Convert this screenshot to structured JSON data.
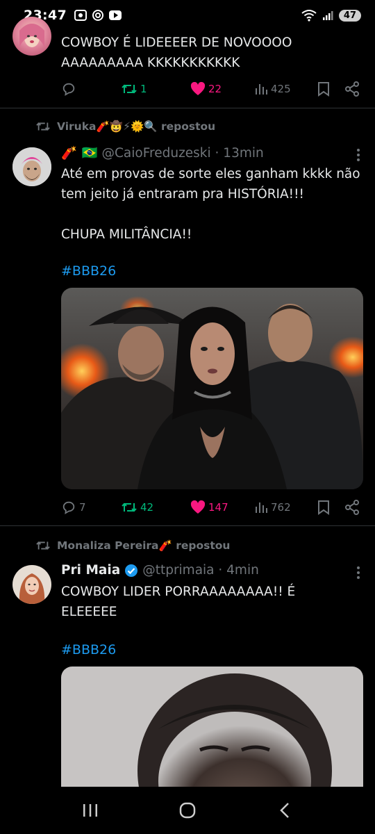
{
  "status_bar": {
    "time": "23:47",
    "battery": "47"
  },
  "tweets": [
    {
      "text": "COWBOY É LIDEEEER DE NOVOOOO\nAAAAAAAAA KKKKKKKKKKK",
      "actions": {
        "replies": "",
        "retweets": "1",
        "likes": "22",
        "views": "425"
      }
    },
    {
      "repost_by": "Viruka🧨🤠⚡🌞🔍 repostou",
      "author_name": "🧨 🇧🇷",
      "author_handle": "@CaioFreduzeski · 13min",
      "text": "Até em provas de sorte eles ganham kkkk não tem jeito já entraram pra HISTÓRIA!!!\n\nCHUPA MILITÂNCIA!!",
      "hashtag": "#BBB26",
      "actions": {
        "replies": "7",
        "retweets": "42",
        "likes": "147",
        "views": "762"
      }
    },
    {
      "repost_by": "Monaliza Pereira🧨 repostou",
      "author_name": "Pri Maia",
      "author_handle": "@ttprimaia · 4min",
      "text": "COWBOY LIDER PORRAAAAAAAA!! É\nELEEEEE",
      "hashtag": "#BBB26"
    }
  ],
  "colors": {
    "accent": "#1d9bf0",
    "retweet": "#00ba7c",
    "like": "#f91880",
    "muted": "#71767b"
  }
}
